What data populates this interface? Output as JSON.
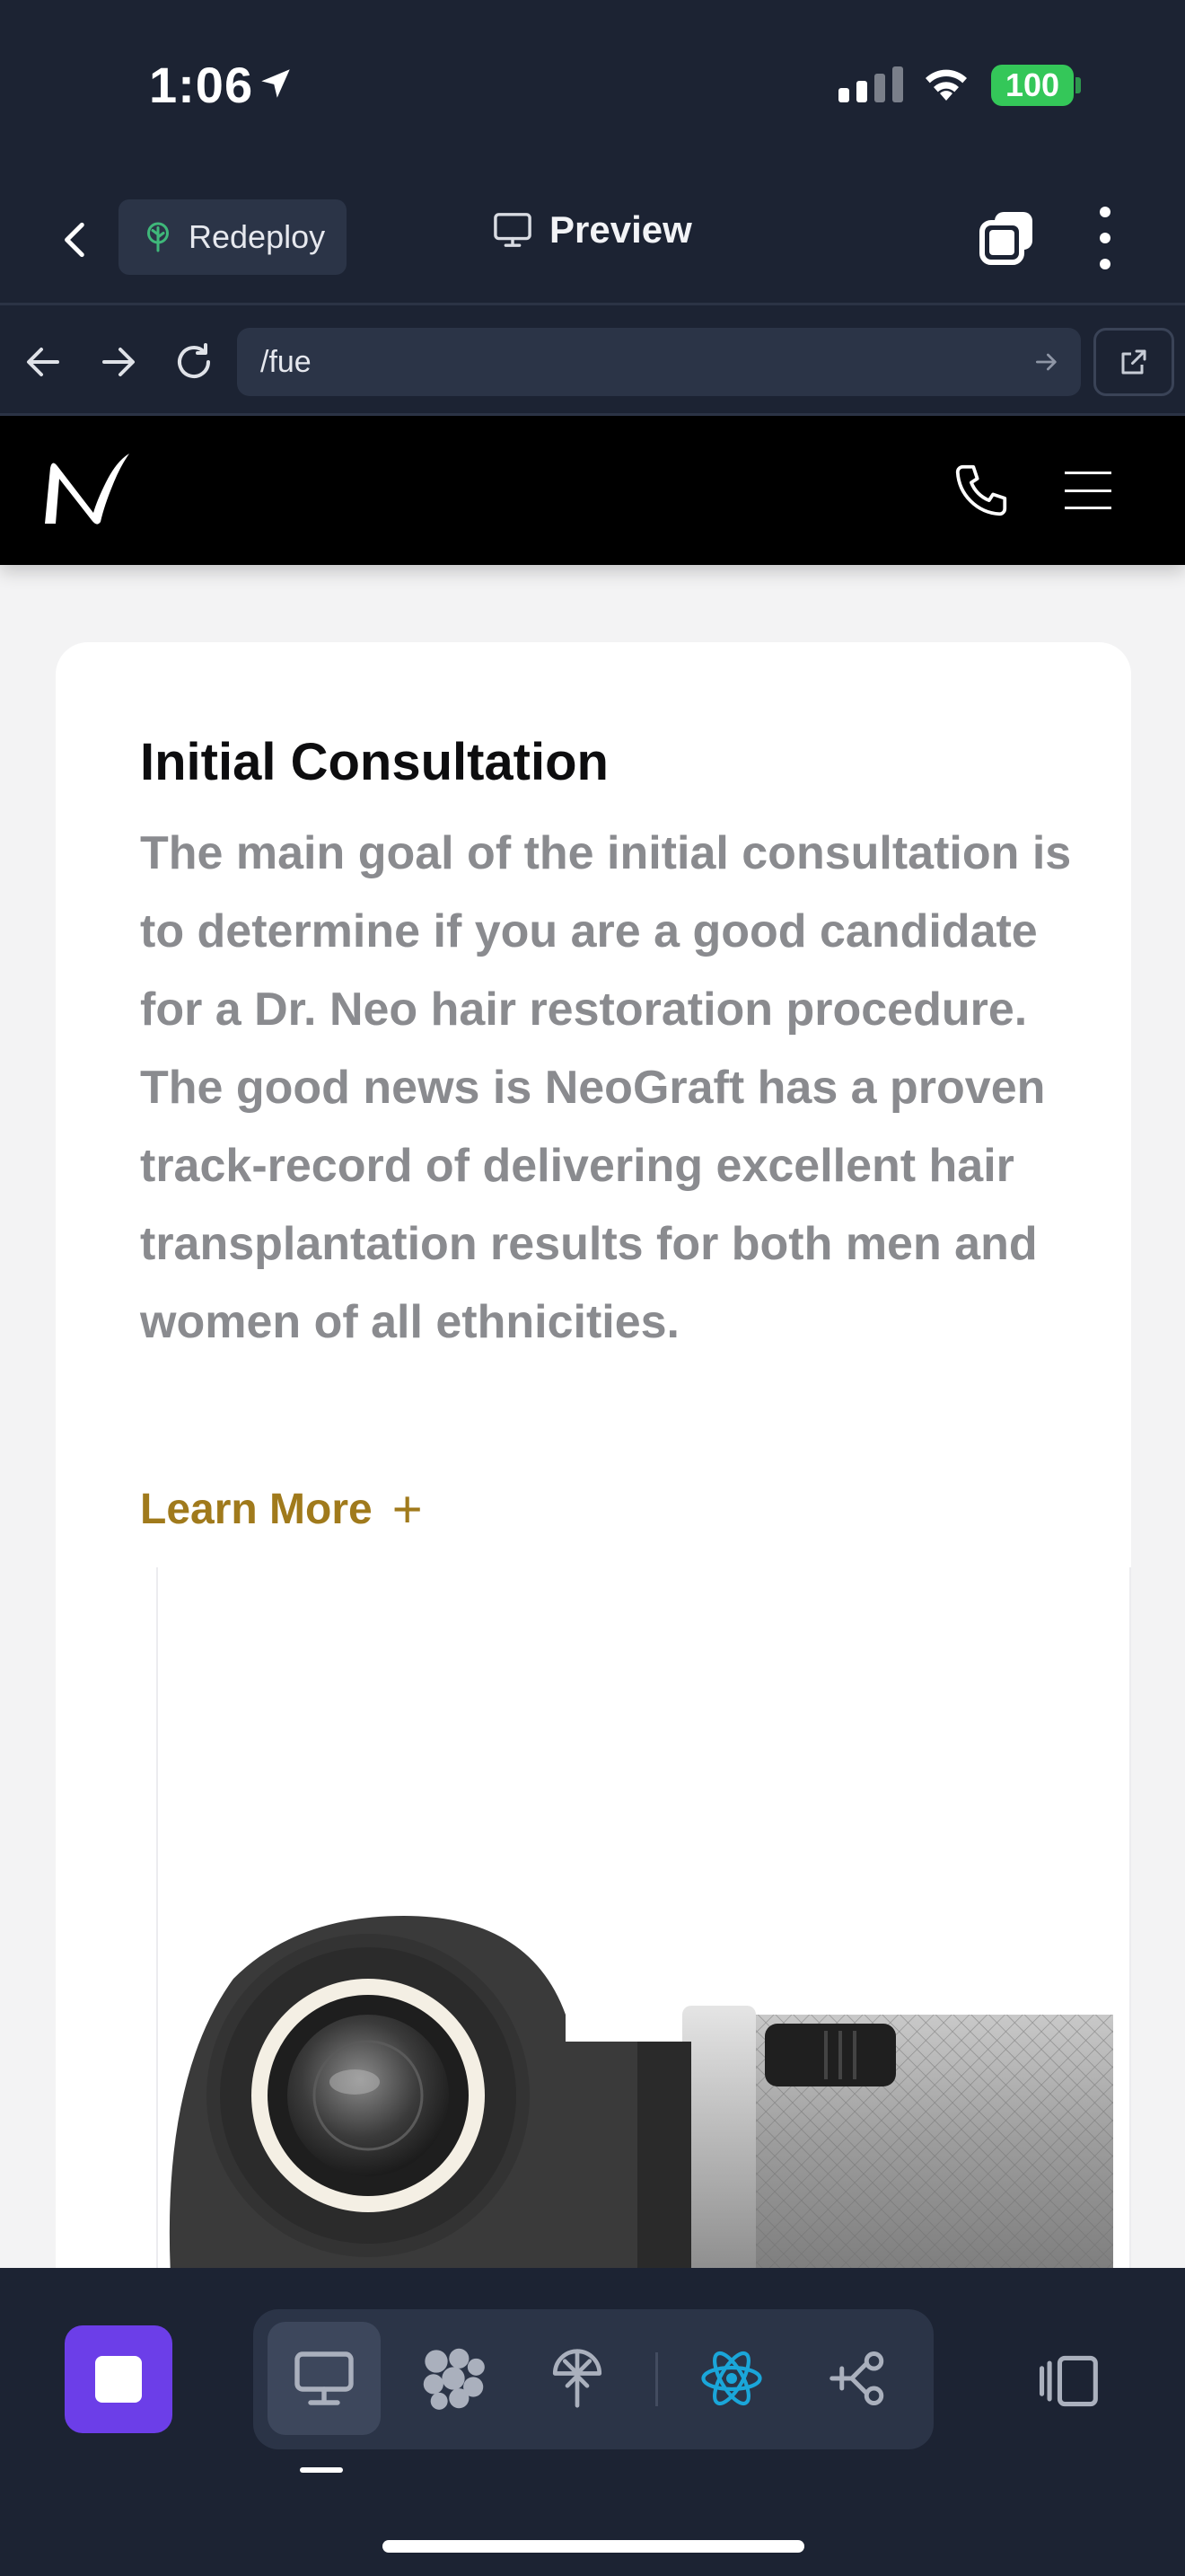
{
  "status_bar": {
    "time": "1:06",
    "battery": "100"
  },
  "toolbar": {
    "redeploy_label": "Redeploy",
    "preview_label": "Preview"
  },
  "urlbar": {
    "url": "/fue"
  },
  "site": {
    "section": {
      "title": "Initial Consultation",
      "body": "The main goal of the initial consultation is to determine if you are a good candidate for a Dr. Neo hair restoration procedure. The good news is NeoGraft has a proven track-record of delivering excellent hair transplantation results for both men and women of all ethnicities.",
      "learn_more": "Learn More",
      "learn_more_icon": "+"
    }
  },
  "colors": {
    "app_bg": "#1c2333",
    "surface": "#2b3447",
    "accent_purple": "#6c3ee8",
    "battery_green": "#34c759",
    "link_gold": "#a07a1c",
    "body_gray": "#8a8b8f"
  },
  "icons": {
    "location": "location-arrow-icon",
    "signal": "cellular-signal-icon",
    "wifi": "wifi-icon",
    "back": "chevron-left-icon",
    "redeploy": "deploy-tree-icon",
    "preview": "monitor-icon",
    "tabs": "tabs-icon",
    "more": "more-vertical-icon",
    "nav_back": "arrow-left-icon",
    "nav_forward": "arrow-right-icon",
    "reload": "reload-icon",
    "go": "arrow-right-small-icon",
    "external": "open-external-icon",
    "site_logo": "neograft-logo-icon",
    "phone": "phone-icon",
    "menu": "hamburger-menu-icon",
    "stop": "stop-icon",
    "desktop": "desktop-icon",
    "cluster": "cluster-icon",
    "deployment": "deployment-icon",
    "react": "react-icon",
    "git": "git-branch-icon",
    "panel": "side-panel-icon"
  }
}
